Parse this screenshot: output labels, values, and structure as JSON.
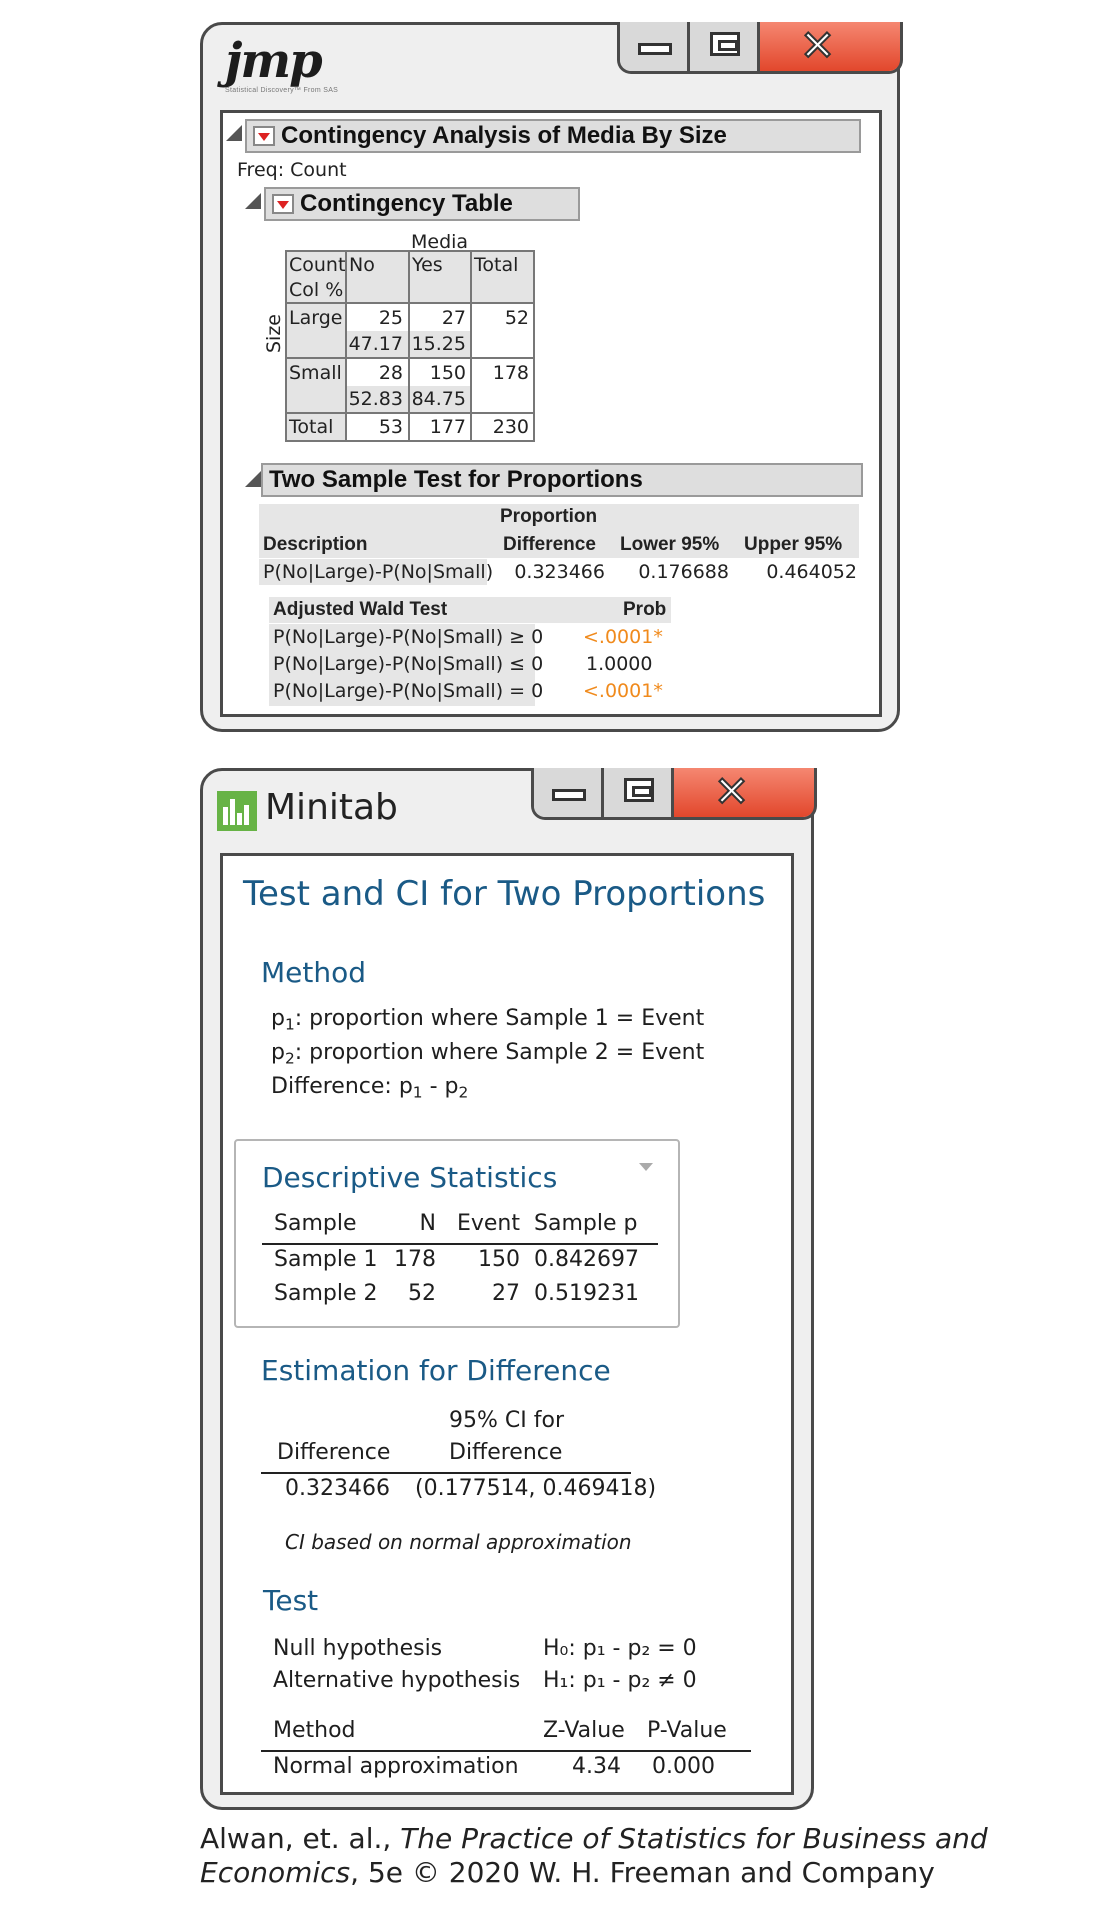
{
  "jmp": {
    "logo_text": "jmp",
    "logo_tagline": "Statistical Discovery™ From SAS",
    "section_title": "Contingency Analysis of Media By Size",
    "freq_label": "Freq: Count",
    "ct_title": "Contingency Table",
    "ct": {
      "col_var": "Media",
      "row_var": "Size",
      "header": [
        "No",
        "Yes",
        "Total"
      ],
      "legend": [
        "Count",
        "Col %"
      ],
      "rows": [
        {
          "label": "Large",
          "counts": [
            "25",
            "27",
            "52"
          ],
          "pcts": [
            "47.17",
            "15.25"
          ]
        },
        {
          "label": "Small",
          "counts": [
            "28",
            "150",
            "178"
          ],
          "pcts": [
            "52.83",
            "84.75"
          ]
        }
      ],
      "total": {
        "label": "Total",
        "values": [
          "53",
          "177",
          "230"
        ]
      }
    },
    "two_sample": {
      "title": "Two Sample Test for Proportions",
      "headers": {
        "description": "Description",
        "proportion": "Proportion",
        "difference": "Difference",
        "lower": "Lower 95%",
        "upper": "Upper 95%"
      },
      "row": {
        "description": "P(No|Large)-P(No|Small)",
        "difference": "0.323466",
        "lower": "0.176688",
        "upper": "0.464052"
      },
      "wald": {
        "title": "Adjusted Wald Test",
        "prob_header": "Prob",
        "rows": [
          {
            "label": "P(No|Large)-P(No|Small) ≥ 0",
            "prob": "<.0001*"
          },
          {
            "label": "P(No|Large)-P(No|Small) ≤ 0",
            "prob": "1.0000"
          },
          {
            "label": "P(No|Large)-P(No|Small) = 0",
            "prob": "<.0001*"
          }
        ]
      }
    }
  },
  "minitab": {
    "app_title": "Minitab",
    "main_title": "Test and CI for Two Proportions",
    "method": {
      "title": "Method",
      "line1_prefix": "p",
      "line1_sub": "1",
      "line1_rest": ": proportion where Sample 1 = Event",
      "line2_prefix": "p",
      "line2_sub": "2",
      "line2_rest": ": proportion where Sample 2 = Event",
      "line3": "Difference: p",
      "line3_sub1": "1",
      "line3_mid": " - p",
      "line3_sub2": "2"
    },
    "descriptive": {
      "title": "Descriptive Statistics",
      "headers": [
        "Sample",
        "N",
        "Event",
        "Sample p"
      ],
      "rows": [
        [
          "Sample 1",
          "178",
          "150",
          "0.842697"
        ],
        [
          "Sample 2",
          "52",
          "27",
          "0.519231"
        ]
      ]
    },
    "estimation": {
      "title": "Estimation for Difference",
      "ci_header_line1": "95% CI for",
      "ci_header_line2": "Difference",
      "diff_header": "Difference",
      "diff_value": "0.323466",
      "ci_value": "(0.177514, 0.469418)",
      "note": "CI based on normal approximation"
    },
    "test": {
      "title": "Test",
      "null_label": "Null hypothesis",
      "null_value": "H₀: p₁ - p₂ = 0",
      "alt_label": "Alternative hypothesis",
      "alt_value": "H₁: p₁ - p₂ ≠ 0",
      "headers": [
        "Method",
        "Z-Value",
        "P-Value"
      ],
      "row": [
        "Normal approximation",
        "4.34",
        "0.000"
      ]
    }
  },
  "caption": {
    "line1_plain": "Alwan, et. al., ",
    "line1_italic": "The Practice of Statistics for Business and",
    "line2_italic": "Economics",
    "line2_plain": ", 5e © 2020 W. H. Freeman and Company"
  }
}
